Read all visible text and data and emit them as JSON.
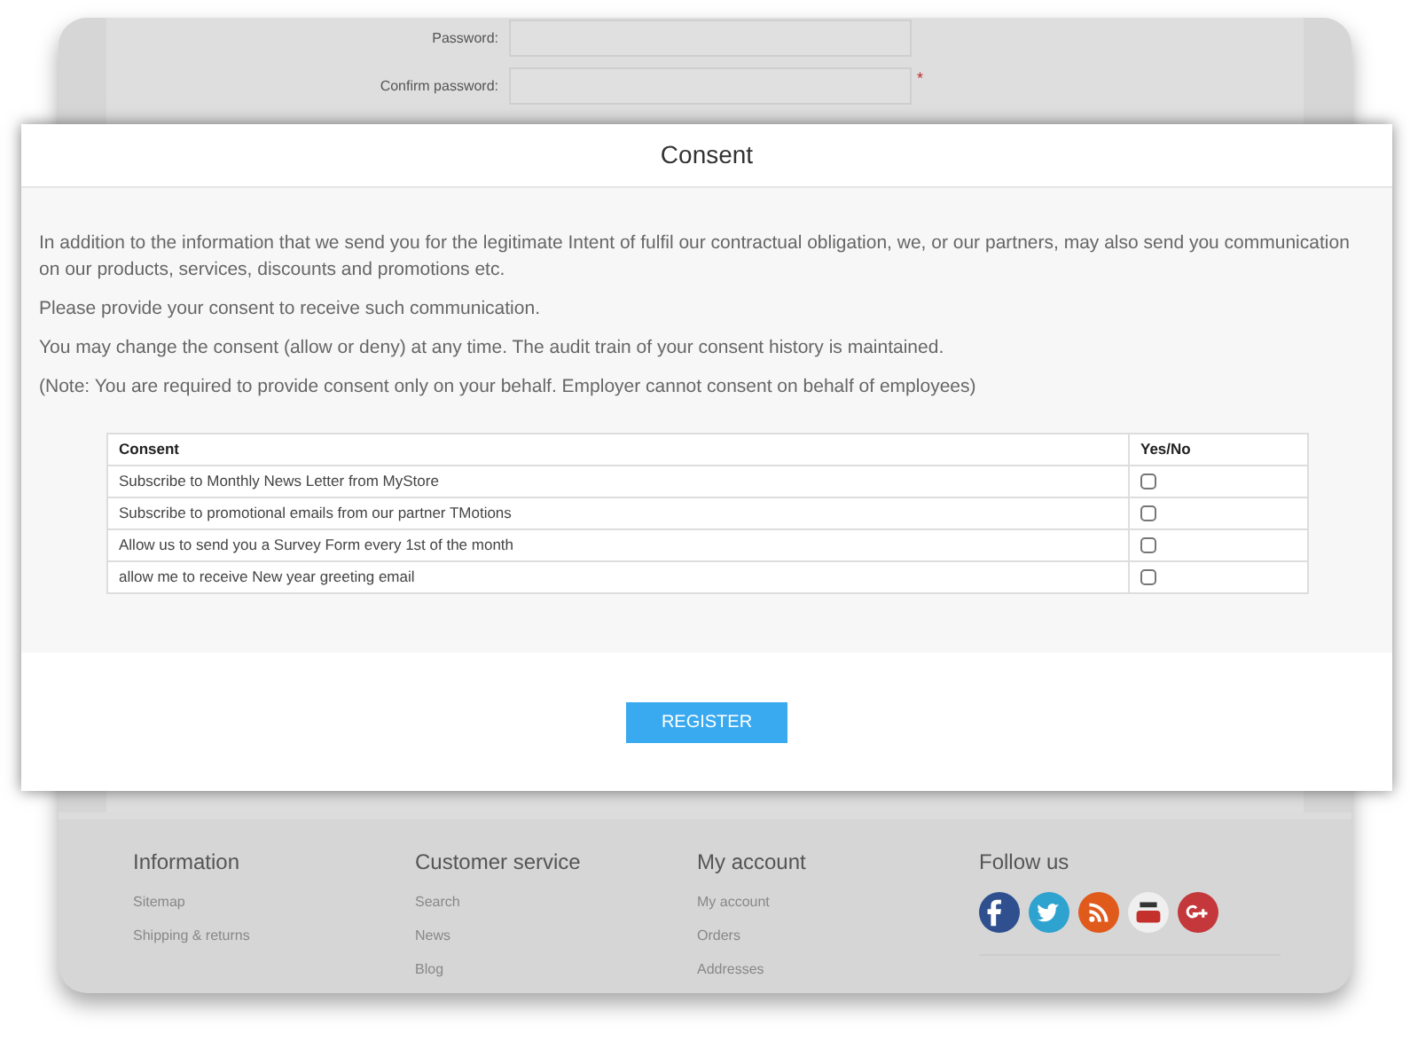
{
  "background_page": {
    "form": [
      {
        "label": "Password:",
        "required": false
      },
      {
        "label": "Confirm password:",
        "required": true
      }
    ],
    "required_mark": "*",
    "footer": [
      {
        "heading": "Information",
        "links": [
          "Sitemap",
          "Shipping & returns"
        ]
      },
      {
        "heading": "Customer service",
        "links": [
          "Search",
          "News",
          "Blog"
        ]
      },
      {
        "heading": "My account",
        "links": [
          "My account",
          "Orders",
          "Addresses"
        ]
      },
      {
        "heading": "Follow us",
        "social": [
          {
            "kind": "facebook"
          },
          {
            "kind": "twitter"
          },
          {
            "kind": "rss"
          },
          {
            "kind": "youtube"
          },
          {
            "kind": "googleplus"
          }
        ]
      }
    ]
  },
  "modal": {
    "title": "Consent",
    "paragraphs": [
      "In addition to the information that we send you for the legitimate Intent of fulfil our contractual obligation, we, or our partners, may also send you communication on our products, services, discounts and promotions etc.",
      "Please provide your consent to receive such communication.",
      "You may change the consent (allow or deny) at any time. The audit train of your consent history is maintained.",
      "(Note: You are required to provide consent only on your behalf. Employer cannot consent on behalf of employees)"
    ],
    "table": {
      "columns": [
        "Consent",
        "Yes/No"
      ],
      "rows": [
        {
          "label": "Subscribe to Monthly News Letter from MyStore",
          "checked": false
        },
        {
          "label": "Subscribe to promotional emails from our partner TMotions",
          "checked": false
        },
        {
          "label": "Allow us to send you a Survey Form every 1st of the month",
          "checked": false
        },
        {
          "label": "allow me to receive New year greeting email",
          "checked": false
        }
      ]
    },
    "button": "REGISTER"
  }
}
